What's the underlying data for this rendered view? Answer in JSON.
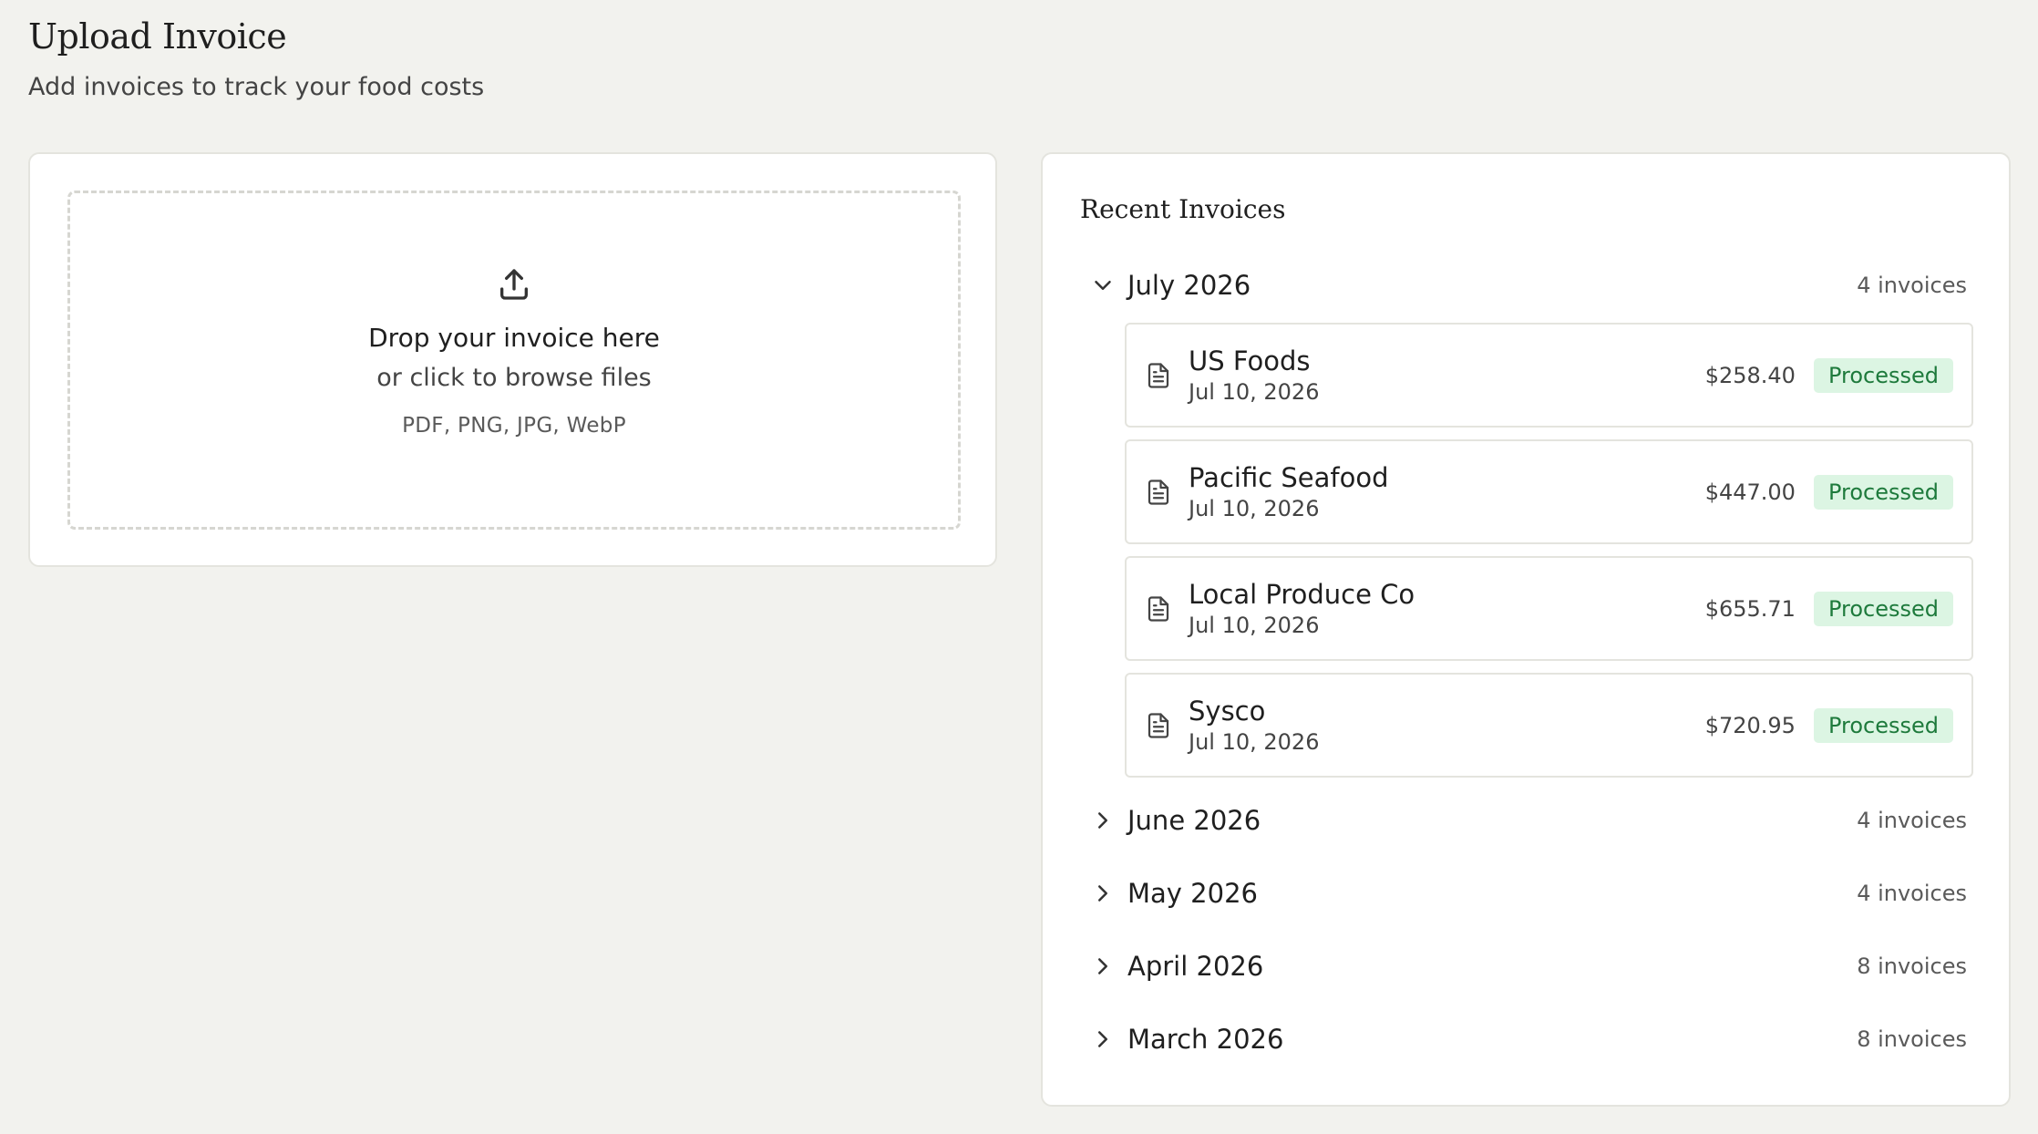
{
  "header": {
    "title": "Upload Invoice",
    "subtitle": "Add invoices to track your food costs"
  },
  "upload": {
    "icon": "upload-icon",
    "title": "Drop your invoice here",
    "subtitle": "or click to browse files",
    "formats": "PDF, PNG, JPG, WebP"
  },
  "recent": {
    "title": "Recent Invoices",
    "months": [
      {
        "label": "July 2026",
        "count": "4 invoices",
        "expanded": true,
        "invoices": [
          {
            "vendor": "US Foods",
            "date": "Jul 10, 2026",
            "amount": "$258.40",
            "status": "Processed"
          },
          {
            "vendor": "Pacific Seafood",
            "date": "Jul 10, 2026",
            "amount": "$447.00",
            "status": "Processed"
          },
          {
            "vendor": "Local Produce Co",
            "date": "Jul 10, 2026",
            "amount": "$655.71",
            "status": "Processed"
          },
          {
            "vendor": "Sysco",
            "date": "Jul 10, 2026",
            "amount": "$720.95",
            "status": "Processed"
          }
        ]
      },
      {
        "label": "June 2026",
        "count": "4 invoices",
        "expanded": false
      },
      {
        "label": "May 2026",
        "count": "4 invoices",
        "expanded": false
      },
      {
        "label": "April 2026",
        "count": "8 invoices",
        "expanded": false
      },
      {
        "label": "March 2026",
        "count": "8 invoices",
        "expanded": false
      }
    ]
  },
  "colors": {
    "background": "#f2f2ee",
    "badge_bg": "#dcf5e3",
    "badge_text": "#1e7a3c"
  }
}
